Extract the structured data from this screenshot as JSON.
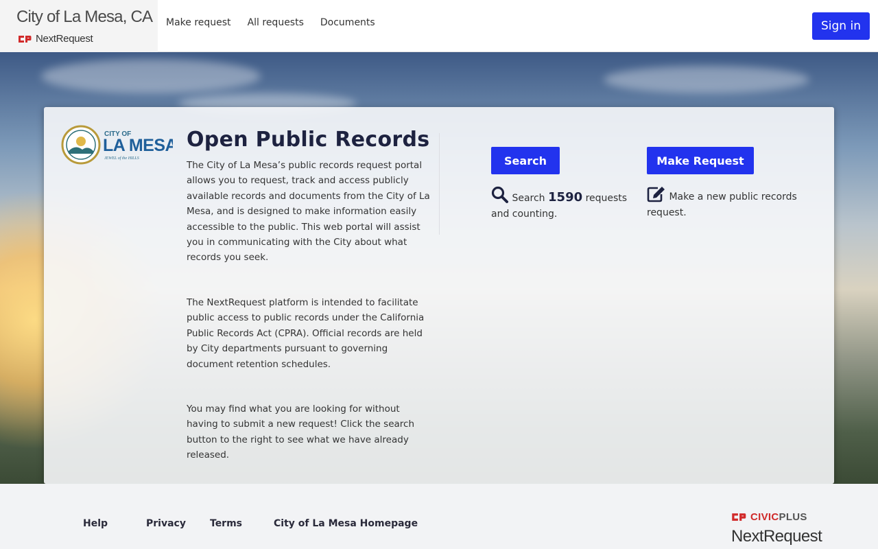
{
  "header": {
    "city_title": "City of La Mesa, CA",
    "brand_sub": "NextRequest",
    "nav": [
      {
        "label": "Make request"
      },
      {
        "label": "All requests"
      },
      {
        "label": "Documents"
      }
    ],
    "signin_label": "Sign in"
  },
  "panel": {
    "seal": {
      "line1": "CITY OF",
      "line2": "LA MESA",
      "line3": "JEWEL of the HILLS"
    },
    "title": "Open Public Records",
    "paragraphs": [
      "The City of La Mesa’s public records request portal allows you to request, track and access publicly available records and documents from the City of La Mesa, and is designed to make information easily accessible to the public. This web portal will assist you in communicating with the City about what records you seek.",
      "The NextRequest platform is intended to facilitate public access to public records under the California Public Records Act (CPRA). Official records are held by City departments pursuant to governing document retention schedules.",
      "You may find what you are looking for without having to submit a new request! Click the search button to the right to see what we have already released."
    ],
    "search": {
      "button_label": "Search",
      "desc_prefix": "Search",
      "count": "1590",
      "desc_suffix": "requests and counting."
    },
    "make_request": {
      "button_label": "Make Request",
      "desc": "Make a new public records request."
    }
  },
  "footer": {
    "links": [
      {
        "label": "Help"
      },
      {
        "label": "Privacy"
      },
      {
        "label": "Terms"
      },
      {
        "label": "City of La Mesa Homepage"
      }
    ],
    "civicplus_civic": "CIVIC",
    "civicplus_plus": "PLUS",
    "nextrequest": "NextRequest"
  },
  "colors": {
    "primary_button": "#2233ee",
    "title": "#1d2240",
    "civicplus_red": "#cf2a2a"
  }
}
